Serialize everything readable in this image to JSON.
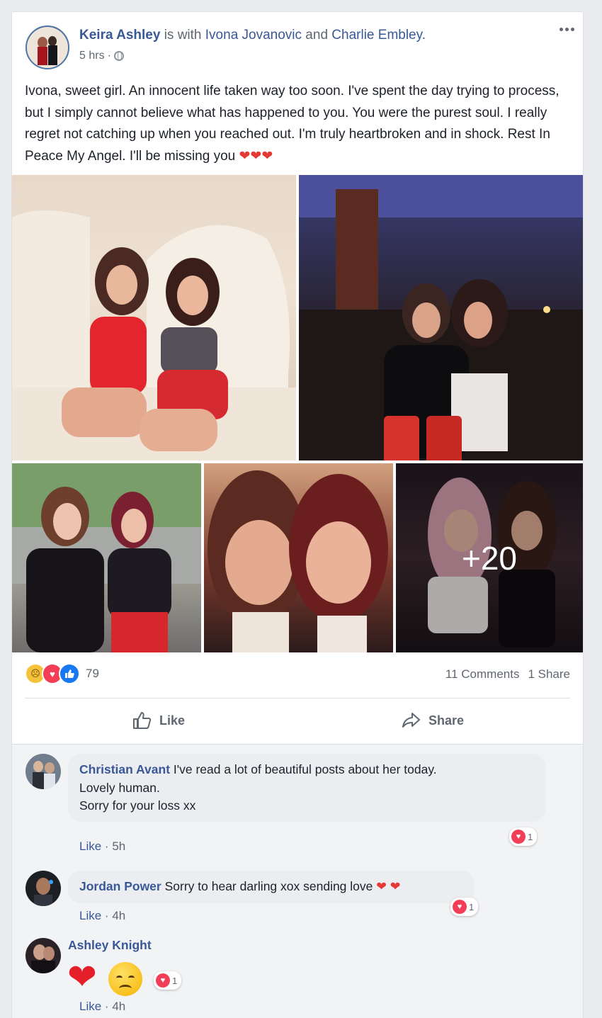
{
  "post": {
    "author": "Keira Ashley",
    "with_text": " is with ",
    "tag1": "Ivona Jovanovic",
    "and_text": " and ",
    "tag2": "Charlie Embley",
    "period": ".",
    "time": "5 hrs",
    "dot": "·",
    "body": "Ivona, sweet girl. An innocent life taken way too soon. I've spent the day trying to process, but I simply cannot believe what has happened to you. You were the purest soul. I really regret not catching up when you reached out. I'm truly heartbroken and in shock. Rest In Peace My Angel. I'll be missing you",
    "hearts": "❤❤❤"
  },
  "photos": {
    "more_count": "+20"
  },
  "engagement": {
    "reaction_icons": [
      "sad-icon",
      "love-icon",
      "like-icon"
    ],
    "reaction_count": "79",
    "comments": "11 Comments",
    "shares": "1 Share"
  },
  "actions": {
    "like_label": "Like",
    "share_label": "Share"
  },
  "comments": [
    {
      "name": "Christian Avant",
      "text_line1": "I've read a lot of beautiful posts about her today.",
      "text_line2": "Lovely human.",
      "text_line3": "Sorry for your loss xx",
      "like_label": "Like",
      "sep": "·",
      "time": "5h",
      "reaction_count": "1"
    },
    {
      "name": "Jordan Power",
      "text": "Sorry to hear darling xox sending love",
      "hearts": "❤ ❤",
      "like_label": "Like",
      "sep": "·",
      "time": "4h",
      "reaction_count": "1"
    },
    {
      "name": "Ashley Knight",
      "emoji": "❤",
      "like_label": "Like",
      "sep": "·",
      "time": "4h",
      "reaction_count": "1"
    }
  ],
  "colors": {
    "link": "#385898",
    "love": "#f33e58",
    "like": "#1877f2",
    "sad": "#f5c33b"
  }
}
